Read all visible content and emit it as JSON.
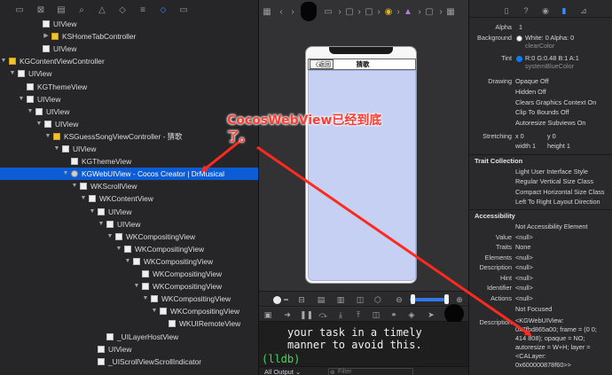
{
  "navigator": {
    "toolbar_icons": [
      "folder-icon",
      "source-control-icon",
      "hierarchy-icon",
      "find-icon",
      "issue-icon",
      "test-icon",
      "debug-icon",
      "breakpoint-icon",
      "report-icon"
    ],
    "rows": [
      {
        "label": "UIView",
        "indent": 38,
        "expander": "",
        "icon": "view"
      },
      {
        "label": "KSHomeTabController",
        "indent": 48,
        "expander": "▶",
        "icon": "controller"
      },
      {
        "label": "UIView",
        "indent": 38,
        "expander": "",
        "icon": "view"
      },
      {
        "label": "KGContentViewController",
        "indent": 0,
        "expander": "▼",
        "icon": "controller"
      },
      {
        "label": "UIView",
        "indent": 10,
        "expander": "▼",
        "icon": "view"
      },
      {
        "label": "KGThemeView",
        "indent": 20,
        "expander": "",
        "icon": "view"
      },
      {
        "label": "UIView",
        "indent": 20,
        "expander": "▼",
        "icon": "view"
      },
      {
        "label": "UIView",
        "indent": 30,
        "expander": "▼",
        "icon": "view"
      },
      {
        "label": "UIView",
        "indent": 40,
        "expander": "▼",
        "icon": "view"
      },
      {
        "label": "KSGuessSongViewController - 猜歌",
        "indent": 50,
        "expander": "▼",
        "icon": "controller"
      },
      {
        "label": "UIView",
        "indent": 60,
        "expander": "▼",
        "icon": "view"
      },
      {
        "label": "KGThemeView",
        "indent": 70,
        "expander": "",
        "icon": "view"
      },
      {
        "label": "KGWebUIView - Cocos Creator | DrMusical",
        "indent": 70,
        "expander": "▼",
        "icon": "web",
        "selected": true
      },
      {
        "label": "WKScrollView",
        "indent": 80,
        "expander": "▼",
        "icon": "view"
      },
      {
        "label": "WKContentView",
        "indent": 90,
        "expander": "▼",
        "icon": "view"
      },
      {
        "label": "UIView",
        "indent": 100,
        "expander": "▼",
        "icon": "view"
      },
      {
        "label": "UIView",
        "indent": 110,
        "expander": "▼",
        "icon": "view"
      },
      {
        "label": "WKCompositingView",
        "indent": 120,
        "expander": "▼",
        "icon": "view"
      },
      {
        "label": "WKCompositingView",
        "indent": 130,
        "expander": "▼",
        "icon": "view"
      },
      {
        "label": "WKCompositingView",
        "indent": 140,
        "expander": "▼",
        "icon": "view"
      },
      {
        "label": "WKCompositingView",
        "indent": 150,
        "expander": "",
        "icon": "view"
      },
      {
        "label": "WKCompositingView",
        "indent": 150,
        "expander": "▼",
        "icon": "view"
      },
      {
        "label": "WKCompositingView",
        "indent": 160,
        "expander": "▼",
        "icon": "view"
      },
      {
        "label": "WKCompositingView",
        "indent": 170,
        "expander": "▼",
        "icon": "view"
      },
      {
        "label": "WKUIRemoteView",
        "indent": 180,
        "expander": "",
        "icon": "view"
      },
      {
        "label": "_UILayerHostView",
        "indent": 110,
        "expander": "",
        "icon": "view"
      },
      {
        "label": "UIView",
        "indent": 100,
        "expander": "",
        "icon": "view"
      },
      {
        "label": "_UIScrollViewScrollIndicator",
        "indent": 100,
        "expander": "",
        "icon": "view"
      }
    ]
  },
  "canvas": {
    "phone": {
      "back_label": "〈返回",
      "title": "猜歌"
    },
    "console": {
      "lines": [
        "your task in a timely",
        "manner to avoid this."
      ],
      "prompt": "(lldb)",
      "output_label": "All Output ⌄",
      "filter_placeholder": "Filter"
    }
  },
  "inspector": {
    "tabs": [
      "file-icon",
      "help-icon",
      "identity-icon",
      "attributes-icon",
      "size-icon"
    ],
    "alpha": {
      "label": "Alpha",
      "value": "1"
    },
    "background": {
      "label": "Background",
      "value": "White: 0 Alpha: 0",
      "sub": "clearColor"
    },
    "tint": {
      "label": "Tint",
      "value": "R:0 G:0.48 B:1 A:1",
      "sub": "systemBlueColor",
      "color": "#0a7aff"
    },
    "drawing": {
      "label": "Drawing",
      "items": [
        "Opaque Off",
        "Hidden Off",
        "Clears Graphics Context On",
        "Clip To Bounds Off",
        "Autoresize Subviews On"
      ]
    },
    "stretching": {
      "label": "Stretching",
      "x": "x  0",
      "y": "y  0",
      "width": "width  1",
      "height": "height  1"
    },
    "trait_collection": {
      "title": "Trait Collection",
      "items": [
        "Light User Interface Style",
        "Regular Vertical Size Class",
        "Compact Horizontal Size Class",
        "Left To Right Layout Direction"
      ]
    },
    "accessibility": {
      "title": "Accessibility",
      "enabled": "Not Accessibility Element",
      "rows": [
        {
          "label": "Value",
          "value": "<null>"
        },
        {
          "label": "Traits",
          "value": "None"
        },
        {
          "label": "Elements",
          "value": "<null>"
        },
        {
          "label": "Description",
          "value": "<null>"
        },
        {
          "label": "Hint",
          "value": "<null>"
        },
        {
          "label": "Identifier",
          "value": "<null>"
        },
        {
          "label": "Actions",
          "value": "<null>"
        },
        {
          "label": "",
          "value": "Not Focused"
        }
      ]
    },
    "description": {
      "label": "Description",
      "lines": [
        "<KGWebUIView:",
        "0x7fbd865a00; frame = (0 0;",
        "414 808); opaque = NO;",
        "autoresize = W+H; layer =",
        "<CALayer:",
        "0x600000878f60>>"
      ]
    }
  },
  "annotation": {
    "line1": "CocosWebView已经到底",
    "line2": "了。",
    "color": "#ff3b30"
  }
}
